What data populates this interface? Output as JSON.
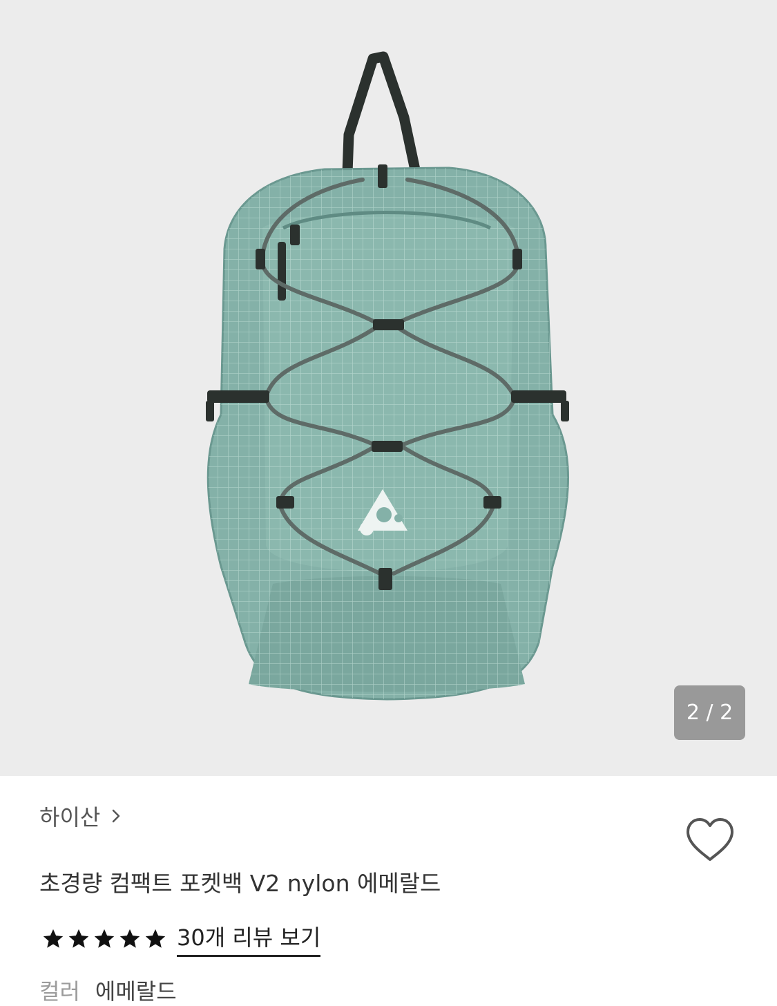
{
  "gallery": {
    "counter": "2 / 2",
    "image_alt": "backpack product image"
  },
  "product": {
    "brand": "하이산",
    "title": "초경량 컴팩트 포켓백 V2 nylon 에메랄드",
    "rating_stars": 5,
    "review_link": "30개 리뷰 보기",
    "color_label": "컬러",
    "color_value": "에메랄드"
  },
  "icons": {
    "brand_chevron": "chevron-right-icon",
    "wishlist": "heart-icon",
    "star": "star-icon"
  },
  "colors": {
    "gallery_bg": "#ececec",
    "bag": "#84b1a8",
    "strap": "#2b312e"
  }
}
